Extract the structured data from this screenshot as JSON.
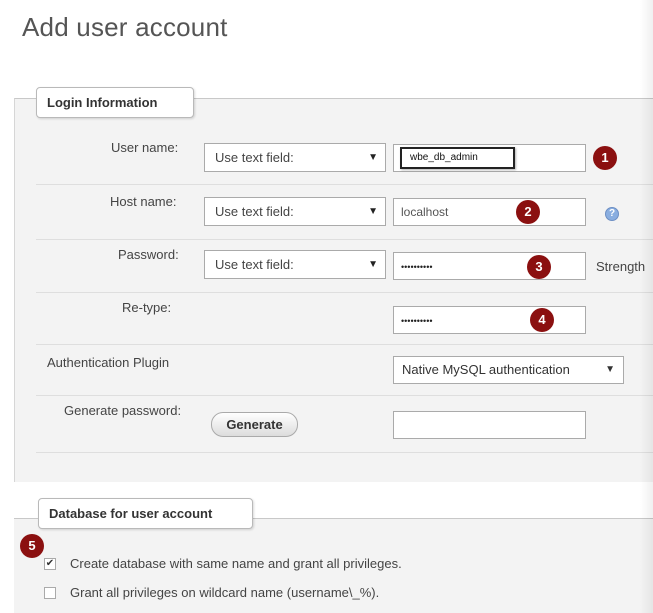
{
  "page": {
    "title": "Add user account"
  },
  "login_section": {
    "legend": "Login Information",
    "user_name": {
      "label": "User name:",
      "select": "Use text field:",
      "value": "wbe_db_admin",
      "badge": "1"
    },
    "host_name": {
      "label": "Host name:",
      "select": "Use text field:",
      "value": "localhost",
      "badge": "2",
      "help_icon": "?"
    },
    "password": {
      "label": "Password:",
      "select": "Use text field:",
      "value": "••••••••••",
      "badge": "3",
      "strength_label": "Strength"
    },
    "retype": {
      "label": "Re-type:",
      "value": "••••••••••",
      "badge": "4"
    },
    "auth_plugin": {
      "label": "Authentication Plugin",
      "select": "Native MySQL authentication"
    },
    "generate": {
      "label": "Generate password:",
      "button": "Generate",
      "value": ""
    }
  },
  "database_section": {
    "legend": "Database for user account",
    "badge": "5",
    "options": [
      {
        "label": "Create database with same name and grant all privileges.",
        "checked": true
      },
      {
        "label": "Grant all privileges on wildcard name (username\\_%).",
        "checked": false
      }
    ]
  },
  "icons": {
    "dropdown": "triangle-down-icon",
    "help": "question-circle-icon",
    "check": "checkmark-icon"
  },
  "colors": {
    "badge": "#8b1010",
    "fieldset_bg": "#f3f3f3",
    "help_icon": "#8aaee0"
  }
}
